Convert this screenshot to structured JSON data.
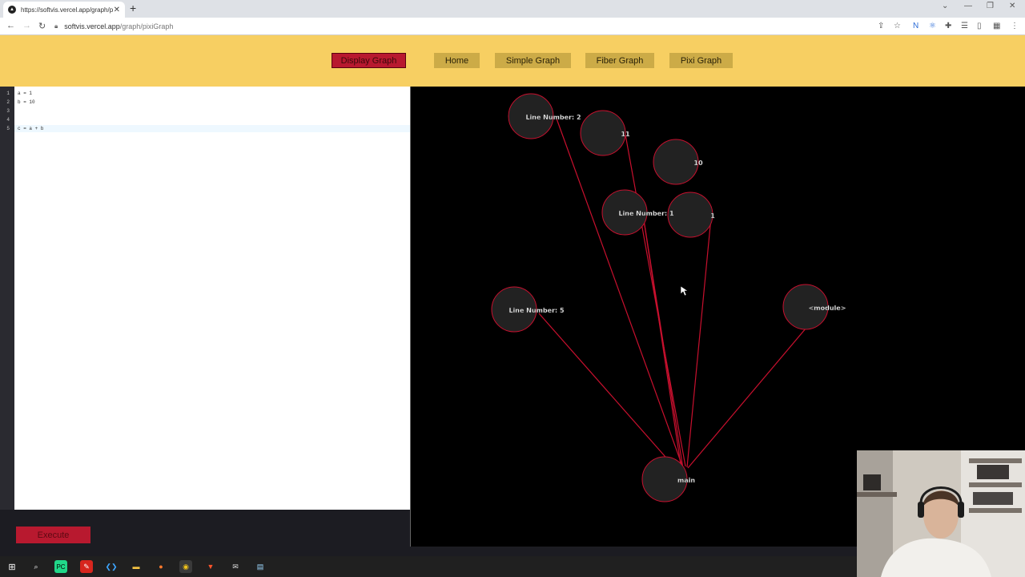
{
  "browser": {
    "tab_title": "https://softvis.vercel.app/graph/p",
    "url_host": "softvis.vercel.app",
    "url_path": "/graph/pixiGraph"
  },
  "header": {
    "buttons": [
      {
        "label": "Display Graph",
        "active": true
      },
      {
        "label": "Home",
        "active": false
      },
      {
        "label": "Simple Graph",
        "active": false
      },
      {
        "label": "Fiber Graph",
        "active": false
      },
      {
        "label": "Pixi Graph",
        "active": false
      }
    ]
  },
  "editor": {
    "line_numbers": [
      "1",
      "2",
      "3",
      "4",
      "5"
    ],
    "lines": [
      "a = 1",
      "b = 10",
      "",
      "",
      "c = a + b"
    ]
  },
  "execute_label": "Execute",
  "graph": {
    "nodes": [
      {
        "id": "ln2",
        "label": "Line Number: 2"
      },
      {
        "id": "n11",
        "label": "11"
      },
      {
        "id": "n10",
        "label": "10"
      },
      {
        "id": "ln1",
        "label": "Line Number: 1"
      },
      {
        "id": "n1",
        "label": "1"
      },
      {
        "id": "ln5",
        "label": "Line Number: 5"
      },
      {
        "id": "module",
        "label": "<module>"
      },
      {
        "id": "main",
        "label": "main"
      }
    ],
    "edges": [
      [
        "ln2",
        "main"
      ],
      [
        "n11",
        "main"
      ],
      [
        "ln1",
        "main"
      ],
      [
        "n1",
        "main"
      ],
      [
        "ln5",
        "main"
      ],
      [
        "module",
        "main"
      ],
      [
        "ln1",
        "main"
      ]
    ],
    "colors": {
      "node_fill": "#222222",
      "node_stroke": "#c8102e",
      "edge": "#c8102e",
      "label_fill": "#ffffff"
    }
  }
}
